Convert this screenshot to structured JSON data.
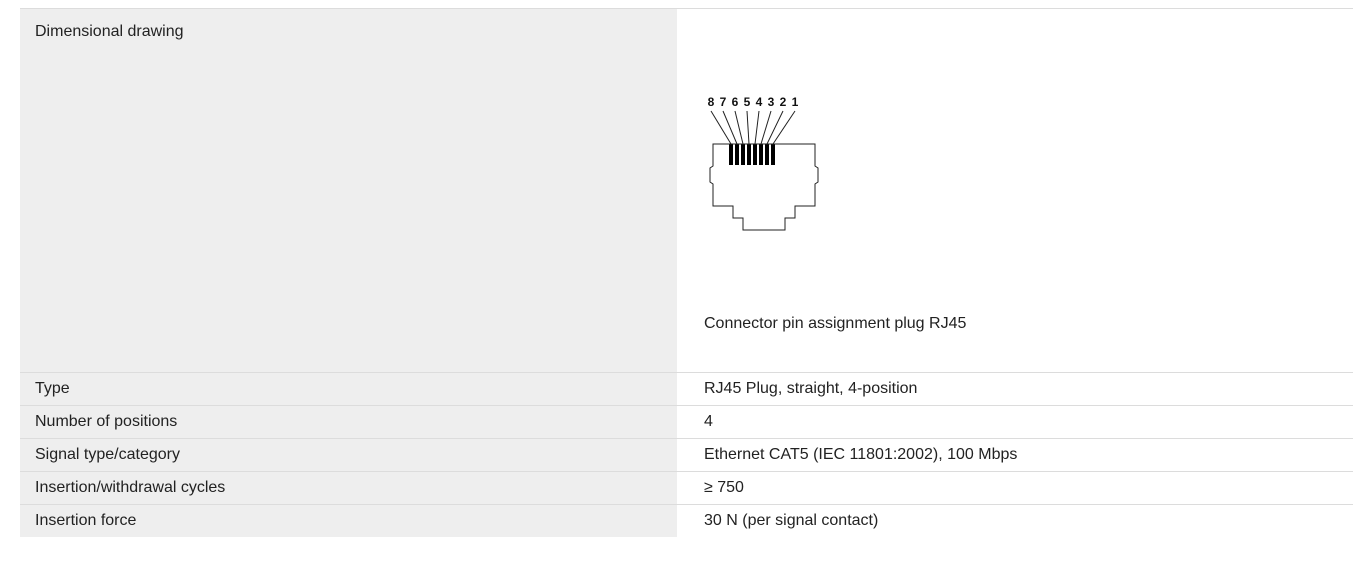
{
  "drawing_section": {
    "label": "Dimensional drawing",
    "pin_numbers": [
      "8",
      "7",
      "6",
      "5",
      "4",
      "3",
      "2",
      "1"
    ],
    "caption": "Connector pin assignment plug RJ45"
  },
  "specs": [
    {
      "label": "Type",
      "value": "RJ45 Plug, straight, 4-position"
    },
    {
      "label": "Number of positions",
      "value": "4"
    },
    {
      "label": "Signal type/category",
      "value": "Ethernet CAT5 (IEC 11801:2002), 100 Mbps"
    },
    {
      "label": "Insertion/withdrawal cycles",
      "value": "≥ 750"
    },
    {
      "label": "Insertion force",
      "value": "30 N (per signal contact)"
    }
  ]
}
